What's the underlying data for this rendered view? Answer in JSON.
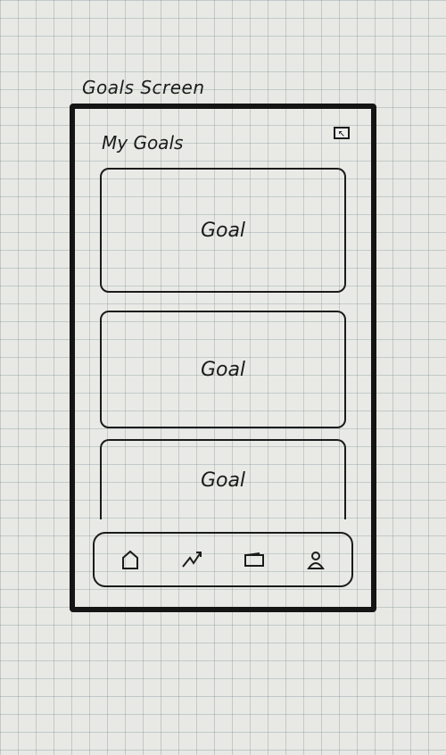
{
  "sheet": {
    "title": "Goals Screen"
  },
  "screen": {
    "title": "My Goals",
    "corner_icon": "profile-card-icon"
  },
  "goals": [
    {
      "label": "Goal"
    },
    {
      "label": "Goal"
    },
    {
      "label": "Goal"
    }
  ],
  "tabbar": {
    "items": [
      {
        "icon": "home-icon"
      },
      {
        "icon": "trend-icon"
      },
      {
        "icon": "wallet-icon"
      },
      {
        "icon": "profile-icon"
      }
    ]
  }
}
